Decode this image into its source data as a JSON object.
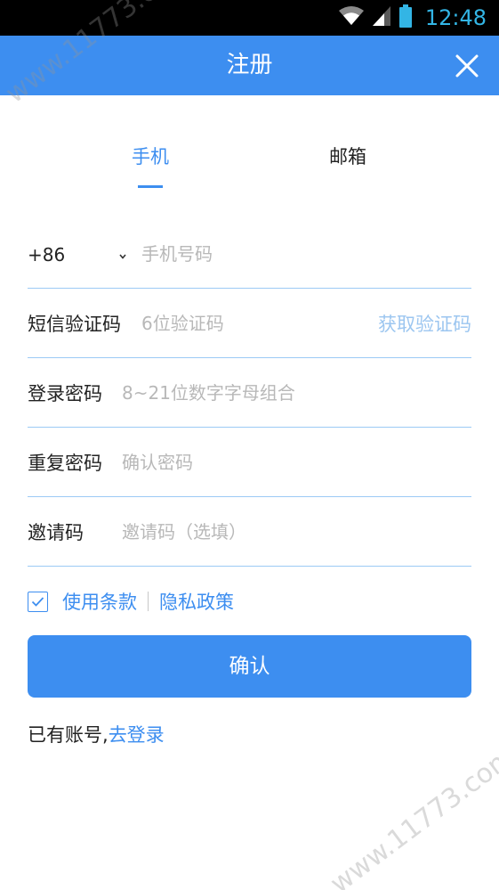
{
  "status_bar": {
    "time": "12:48",
    "icons": [
      "wifi-icon",
      "signal-icon",
      "battery-icon"
    ],
    "bg_color": "#000000",
    "time_color": "#33b5e5"
  },
  "header": {
    "title": "注册",
    "close_icon": "close-icon",
    "bg_color": "#3d8ef0"
  },
  "tabs": [
    {
      "label": "手机",
      "active": true
    },
    {
      "label": "邮箱",
      "active": false
    }
  ],
  "form": {
    "phone": {
      "country_code": "+86",
      "placeholder": "手机号码",
      "value": ""
    },
    "sms": {
      "label": "短信验证码",
      "placeholder": "6位验证码",
      "value": "",
      "get_code": "获取验证码"
    },
    "password": {
      "label": "登录密码",
      "placeholder": "8~21位数字字母组合",
      "value": ""
    },
    "repeat_password": {
      "label": "重复密码",
      "placeholder": "确认密码",
      "value": ""
    },
    "invite": {
      "label": "邀请码",
      "placeholder": "邀请码（选填）",
      "value": ""
    }
  },
  "terms": {
    "checked": true,
    "terms_link": "使用条款",
    "privacy_link": "隐私政策"
  },
  "confirm_label": "确认",
  "login": {
    "prefix": "已有账号,",
    "link": "去登录"
  },
  "watermark": "www.11773.com",
  "colors": {
    "accent": "#3d8ef0",
    "divider": "#9ccaf5",
    "placeholder": "#b8b8b8",
    "get_code": "#9cc6f0"
  }
}
